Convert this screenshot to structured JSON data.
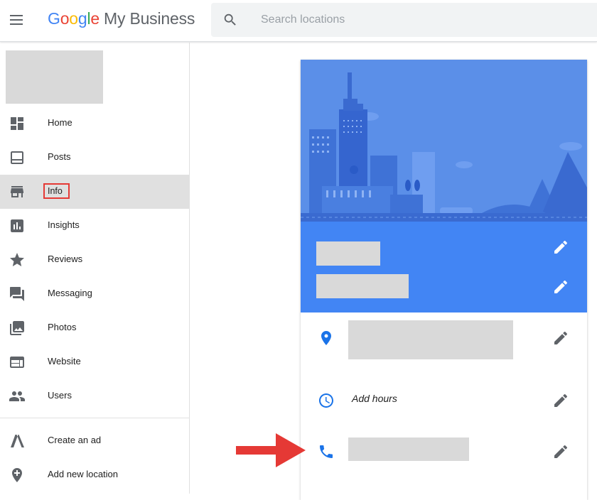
{
  "app": {
    "logo_letters": [
      "G",
      "o",
      "o",
      "g",
      "l",
      "e"
    ],
    "logo_suffix": "My Business"
  },
  "search": {
    "placeholder": "Search locations",
    "value": ""
  },
  "sidebar": {
    "items": [
      {
        "label": "Home",
        "icon": "dashboard-icon"
      },
      {
        "label": "Posts",
        "icon": "posts-icon"
      },
      {
        "label": "Info",
        "icon": "storefront-icon",
        "active": true,
        "highlighted": true
      },
      {
        "label": "Insights",
        "icon": "bar-chart-icon"
      },
      {
        "label": "Reviews",
        "icon": "star-icon"
      },
      {
        "label": "Messaging",
        "icon": "chat-icon"
      },
      {
        "label": "Photos",
        "icon": "photo-icon"
      },
      {
        "label": "Website",
        "icon": "web-icon"
      },
      {
        "label": "Users",
        "icon": "people-icon"
      }
    ],
    "bottom_items": [
      {
        "label": "Create an ad",
        "icon": "google-ads-icon"
      },
      {
        "label": "Add new location",
        "icon": "add-location-icon"
      }
    ]
  },
  "card": {
    "hours_label": "Add hours",
    "icons": [
      "location-pin-icon",
      "clock-icon",
      "phone-icon",
      "edit-pencil-icon"
    ]
  },
  "colors": {
    "accent": "#4285f4",
    "hero_bg": "#5b8fe8",
    "highlight_box": "#e53935",
    "arrow": "#e53935",
    "active_nav_bg": "#e0e0e0"
  }
}
